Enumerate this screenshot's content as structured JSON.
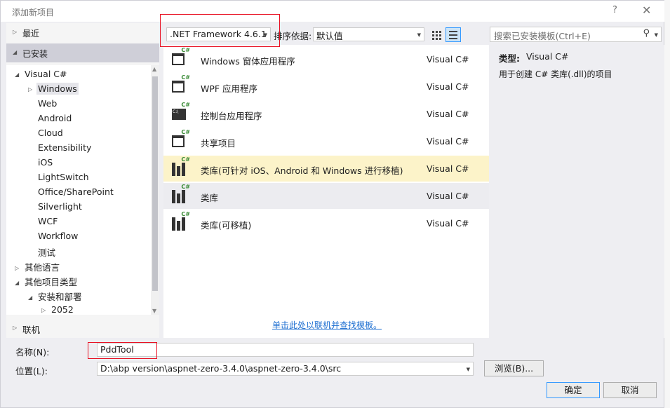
{
  "window": {
    "title": "添加新项目",
    "help": "?",
    "close": "✕"
  },
  "left": {
    "recent": "最近",
    "installed": "已安装",
    "online": "联机",
    "tree": [
      {
        "label": "Visual C#",
        "arrow": "◢"
      },
      {
        "label": "Windows",
        "arrow": "▷"
      },
      {
        "label": "Web",
        "arrow": ""
      },
      {
        "label": "Android",
        "arrow": ""
      },
      {
        "label": "Cloud",
        "arrow": ""
      },
      {
        "label": "Extensibility",
        "arrow": ""
      },
      {
        "label": "iOS",
        "arrow": ""
      },
      {
        "label": "LightSwitch",
        "arrow": ""
      },
      {
        "label": "Office/SharePoint",
        "arrow": ""
      },
      {
        "label": "Silverlight",
        "arrow": ""
      },
      {
        "label": "WCF",
        "arrow": ""
      },
      {
        "label": "Workflow",
        "arrow": ""
      },
      {
        "label": "测试",
        "arrow": ""
      },
      {
        "label": "其他语言",
        "arrow": "▷"
      },
      {
        "label": "其他项目类型",
        "arrow": "◢"
      },
      {
        "label": "安装和部署",
        "arrow": "◢"
      },
      {
        "label": "2052",
        "arrow": "▷"
      }
    ]
  },
  "toolbar": {
    "framework": ".NET Framework 4.6.1",
    "sort_label": "排序依据:",
    "sort_value": "默认值"
  },
  "search": {
    "placeholder": "搜索已安装模板(Ctrl+E)"
  },
  "templates": [
    {
      "name": "Windows 窗体应用程序",
      "lang": "Visual C#",
      "icon": "windows-forms-icon"
    },
    {
      "name": "WPF 应用程序",
      "lang": "Visual C#",
      "icon": "wpf-app-icon"
    },
    {
      "name": "控制台应用程序",
      "lang": "Visual C#",
      "icon": "console-app-icon"
    },
    {
      "name": "共享项目",
      "lang": "Visual C#",
      "icon": "shared-project-icon"
    },
    {
      "name": "类库(可针对 iOS、Android 和 Windows 进行移植)",
      "lang": "Visual C#",
      "icon": "class-library-icon"
    },
    {
      "name": "类库",
      "lang": "Visual C#",
      "icon": "class-library-icon"
    },
    {
      "name": "类库(可移植)",
      "lang": "Visual C#",
      "icon": "class-library-icon"
    }
  ],
  "online_link": "单击此处以联机并查找模板。",
  "info": {
    "type_key": "类型:",
    "type_value": "Visual C#",
    "description": "用于创建 C# 类库(.dll)的项目"
  },
  "form": {
    "name_label": "名称(N):",
    "name_value": "PddTool",
    "location_label": "位置(L):",
    "location_value": "D:\\abp version\\aspnet-zero-3.4.0\\aspnet-zero-3.4.0\\src",
    "browse": "浏览(B)...",
    "ok": "确定",
    "cancel": "取消"
  },
  "colors": {
    "highlight": "#fcf3c9",
    "selected": "#ececf0",
    "link": "#1e6fd1",
    "annotation": "#e81123",
    "csharp": "#388a34"
  }
}
